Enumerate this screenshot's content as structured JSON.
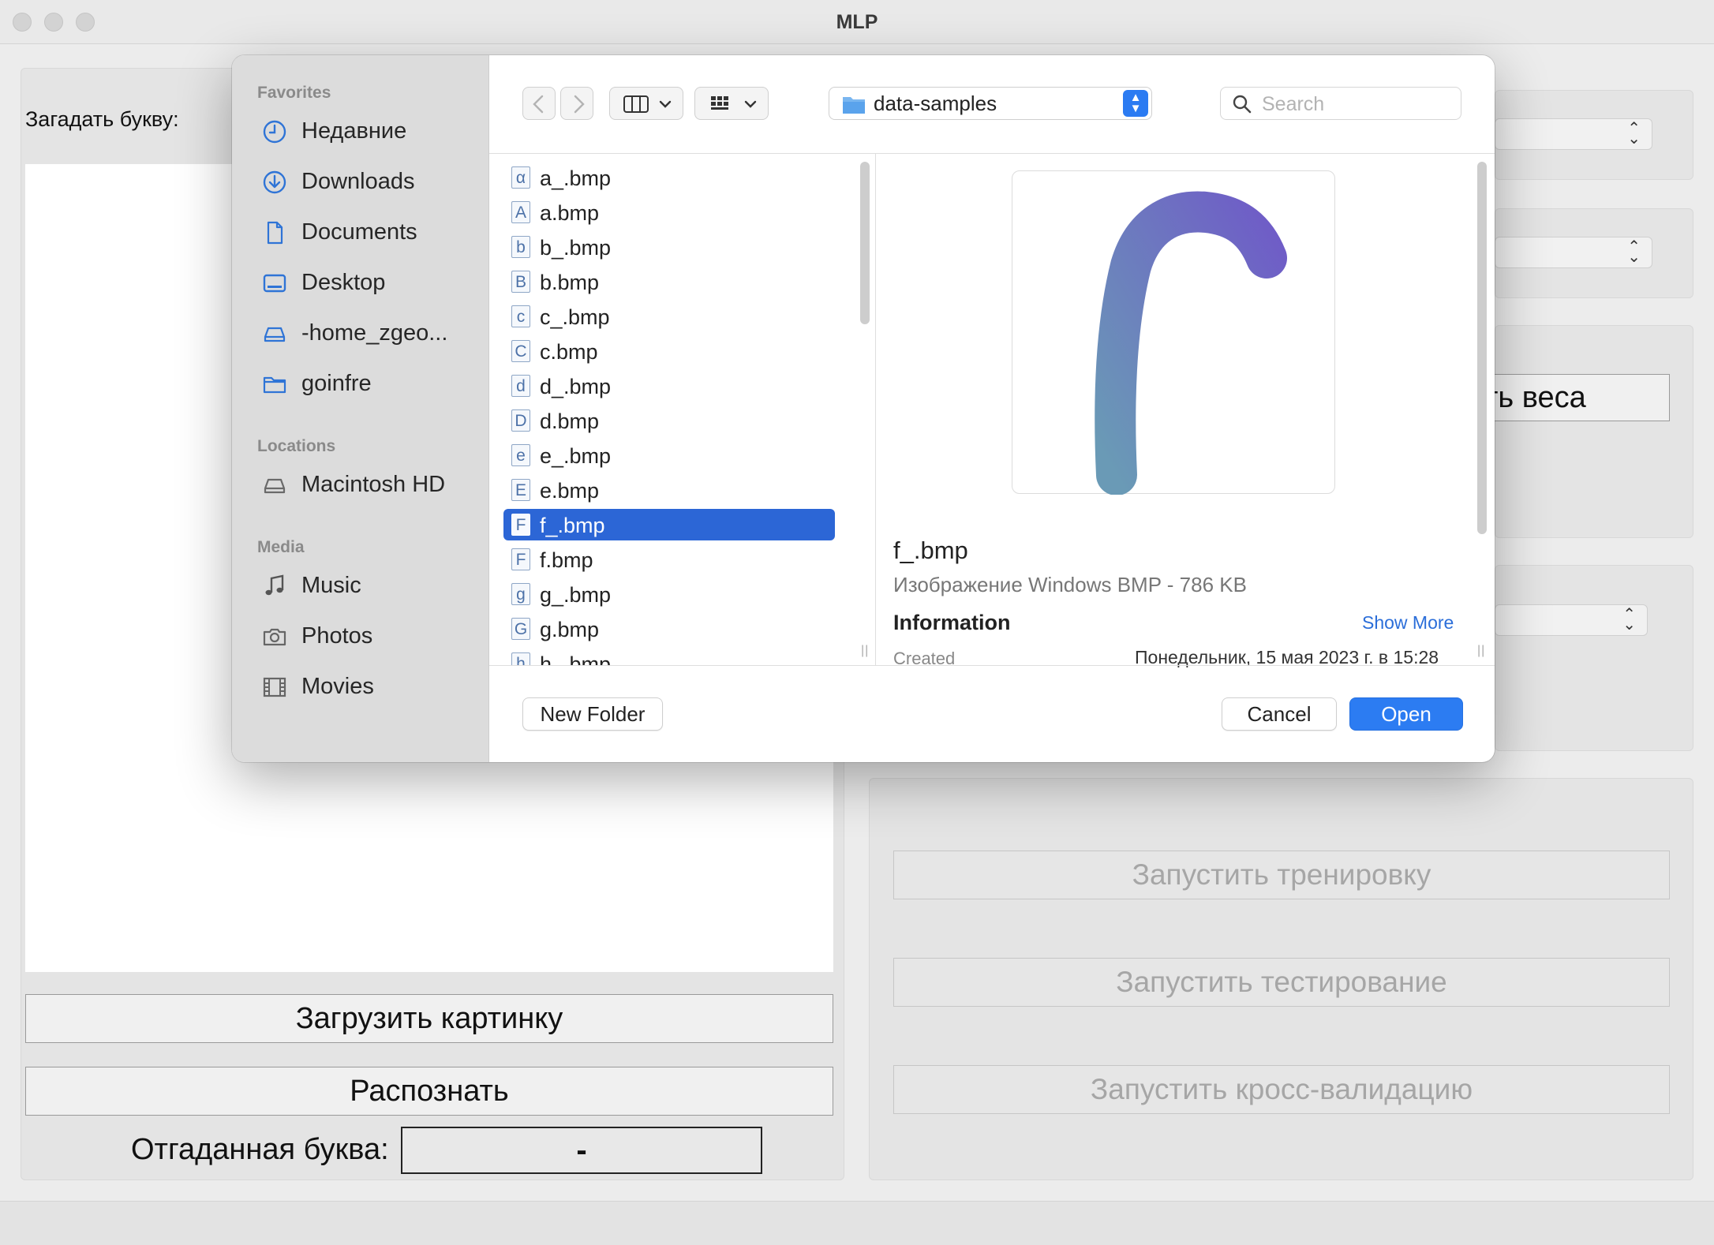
{
  "window": {
    "title": "MLP"
  },
  "left_panel": {
    "guess_label": "Загадать букву:",
    "load_button": "Загрузить картинку",
    "recognize_button": "Распознать",
    "guessed_label": "Отгаданная буква:",
    "guessed_value": "-"
  },
  "right_panel": {
    "weights_button_partial": "ть веса",
    "train_button": "Запустить тренировку",
    "test_button": "Запустить тестирование",
    "crossval_button": "Запустить кросс-валидацию"
  },
  "dialog": {
    "sidebar": {
      "favorites_header": "Favorites",
      "favorites": [
        {
          "label": "Недавние",
          "icon": "clock-icon"
        },
        {
          "label": "Downloads",
          "icon": "download-icon"
        },
        {
          "label": "Documents",
          "icon": "document-icon"
        },
        {
          "label": "Desktop",
          "icon": "desktop-icon"
        },
        {
          "label": "-home_zgeo...",
          "icon": "drive-icon"
        },
        {
          "label": "goinfre",
          "icon": "folder-icon"
        }
      ],
      "locations_header": "Locations",
      "locations": [
        {
          "label": "Macintosh HD",
          "icon": "harddisk-icon"
        }
      ],
      "media_header": "Media",
      "media": [
        {
          "label": "Music",
          "icon": "music-icon"
        },
        {
          "label": "Photos",
          "icon": "camera-icon"
        },
        {
          "label": "Movies",
          "icon": "film-icon"
        }
      ]
    },
    "toolbar": {
      "current_folder": "data-samples",
      "search_placeholder": "Search"
    },
    "files": [
      {
        "name": "a_.bmp",
        "glyph": "α"
      },
      {
        "name": "a.bmp",
        "glyph": "A"
      },
      {
        "name": "b_.bmp",
        "glyph": "b"
      },
      {
        "name": "b.bmp",
        "glyph": "B"
      },
      {
        "name": "c_.bmp",
        "glyph": "c"
      },
      {
        "name": "c.bmp",
        "glyph": "C"
      },
      {
        "name": "d_.bmp",
        "glyph": "d"
      },
      {
        "name": "d.bmp",
        "glyph": "D"
      },
      {
        "name": "e_.bmp",
        "glyph": "e"
      },
      {
        "name": "e.bmp",
        "glyph": "E"
      },
      {
        "name": "f_.bmp",
        "glyph": "F",
        "selected": true
      },
      {
        "name": "f.bmp",
        "glyph": "F"
      },
      {
        "name": "g_.bmp",
        "glyph": "g"
      },
      {
        "name": "g.bmp",
        "glyph": "G"
      },
      {
        "name": "h_.bmp",
        "glyph": "h"
      }
    ],
    "preview": {
      "name": "f_.bmp",
      "kind": "Изображение Windows BMP - 786 KB",
      "info_header": "Information",
      "show_more": "Show More",
      "created_label": "Created",
      "created_value": "Понедельник, 15 мая 2023 г. в 15:28",
      "gradient_colors": [
        "#6a9ab6",
        "#6f5cc7"
      ]
    },
    "buttons": {
      "new_folder": "New Folder",
      "cancel": "Cancel",
      "open": "Open"
    },
    "accent_color": "#2c7cf2"
  }
}
